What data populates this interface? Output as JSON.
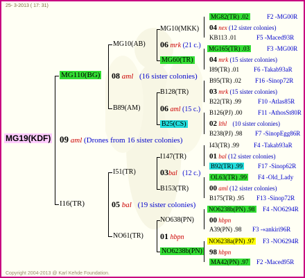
{
  "header": {
    "date": "25-  3-2013 ( 17: 31)"
  },
  "footer": {
    "copyright": "Copyright 2004-2013 @ Karl Kehde Foundation."
  },
  "root": {
    "id": "MG19(KDF)",
    "num": "09",
    "breeder": "aml",
    "note": "(Drones from 16 sister colonies)"
  },
  "n": [
    {
      "id": "MG110(BG)",
      "num": "08",
      "breeder": "aml",
      "note": "(16 sister colonies)"
    },
    {
      "id": "I16(TR)",
      "num": "05",
      "breeder": "bal",
      "note": "(19 sister colonies)"
    },
    {
      "id": "MG10(AB)",
      "num": "06",
      "breeder": "mrk",
      "note": "(21 c.)"
    },
    {
      "id": "B89(AM)",
      "num": "06",
      "breeder": "aml",
      "note": "(15 c.)"
    },
    {
      "id": "I51(TR)",
      "num": "03",
      "breeder": "bal",
      "note": "(12 c.)"
    },
    {
      "id": "NO61(TR)",
      "num": "01",
      "breeder": "hbpn",
      "note": ""
    },
    {
      "id": "MG10(MKK)"
    },
    {
      "id": "MG60(TR)"
    },
    {
      "id": "B128(TR)"
    },
    {
      "id": "B25(CS)"
    },
    {
      "id": "I147(TR)"
    },
    {
      "id": "B153(TR)"
    },
    {
      "id": "NO638(PN)"
    },
    {
      "id": "NO6238b(PN)"
    }
  ],
  "r": [
    {
      "id": "MG82(TR) .02",
      "loc": "F2 -MG00R"
    },
    {
      "num": "04",
      "breeder": "nex",
      "note": "(12 sister colonies)"
    },
    {
      "id": "KB113 .01",
      "loc": "F5 -Maced93R"
    },
    {
      "id": "MG165(TR) .03",
      "loc": "F3 -MG00R"
    },
    {
      "num": "04",
      "breeder": "mrk",
      "note": "(15 sister colonies)"
    },
    {
      "id": "I89(TR) .01",
      "loc": "F6 -Takab93aR"
    },
    {
      "id": "B95(TR) .02",
      "loc": "F16 -Sinop72R"
    },
    {
      "num": "03",
      "breeder": "mrk",
      "note": "(15 sister colonies)"
    },
    {
      "id": "B22(TR) .99",
      "loc": "F10 -Atlas85R"
    },
    {
      "id": "B126(PJ) .00",
      "loc": "F11 -AthosSt80R"
    },
    {
      "num": "02",
      "breeder": "lthl",
      "note": "(10 sister colonies)"
    },
    {
      "id": "B238(PJ) .98",
      "loc": "F7 -SinopEgg86R"
    },
    {
      "id": "I43(TR) .99",
      "loc": "F4 -Takab93aR"
    },
    {
      "num": "01",
      "breeder": "bal",
      "note": "(12 sister colonies)"
    },
    {
      "id": "B92(TR) .99",
      "loc": "F17 -Sinop62R"
    },
    {
      "id": "OL63(TR) .99",
      "loc": "F4 -Old_Lady"
    },
    {
      "num": "00",
      "breeder": "aml",
      "note": "(12 sister colonies)"
    },
    {
      "id": "B175(TR) .95",
      "loc": "F13 -Sinop72R"
    },
    {
      "id": "NO6238b(PN) .98",
      "loc": "F4 -NO6294R"
    },
    {
      "num": "00",
      "breeder": "hbpn",
      "note": ""
    },
    {
      "id": "A39(PN) .98",
      "loc": "F3 -«ankiri96R"
    },
    {
      "id": "NO6238a(PN) .97",
      "loc": "F3 -NO6294R"
    },
    {
      "num": "98",
      "breeder": "hbpn",
      "note": ""
    },
    {
      "id": "MA42(PN) .97",
      "loc": "F2 -Maced95R"
    }
  ]
}
